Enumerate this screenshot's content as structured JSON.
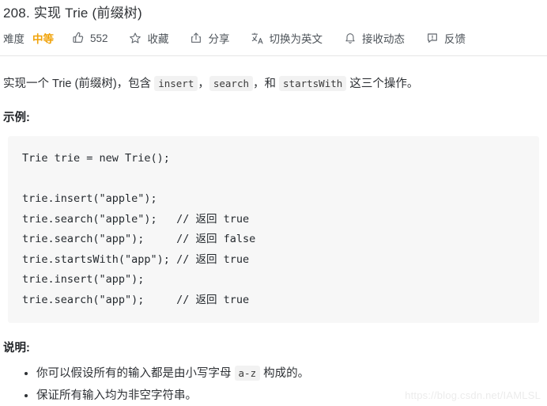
{
  "page": {
    "title": "208. 实现 Trie (前缀树)"
  },
  "toolbar": {
    "difficulty_label": "难度",
    "difficulty_value": "中等",
    "like_count": "552",
    "favorite_label": "收藏",
    "share_label": "分享",
    "translate_label": "切换为英文",
    "subscribe_label": "接收动态",
    "feedback_label": "反馈",
    "icons": {
      "like": "thumbs-up-icon",
      "favorite": "star-icon",
      "share": "share-icon",
      "translate": "translate-icon",
      "subscribe": "bell-icon",
      "feedback": "feedback-icon"
    }
  },
  "description": {
    "part1": "实现一个 Trie (前缀树)，包含 ",
    "code1": "insert",
    "part2": "，",
    "code2": "search",
    "part3": "，和 ",
    "code3": "startsWith",
    "part4": " 这三个操作。"
  },
  "example": {
    "heading": "示例:",
    "code": "Trie trie = new Trie();\n\ntrie.insert(\"apple\");\ntrie.search(\"apple\");   // 返回 true\ntrie.search(\"app\");     // 返回 false\ntrie.startsWith(\"app\"); // 返回 true\ntrie.insert(\"app\");\ntrie.search(\"app\");     // 返回 true"
  },
  "notes": {
    "heading": "说明:",
    "item1_part1": "你可以假设所有的输入都是由小写字母 ",
    "item1_code": "a-z",
    "item1_part2": " 构成的。",
    "item2": "保证所有输入均为非空字符串。"
  },
  "watermark": {
    "text": "https://blog.csdn.net/IAMLSL"
  },
  "colors": {
    "difficulty_medium": "#f0a30a",
    "code_bg": "#f7f7f7",
    "inline_code_bg": "#f2f2f2",
    "text": "#2e3135"
  }
}
